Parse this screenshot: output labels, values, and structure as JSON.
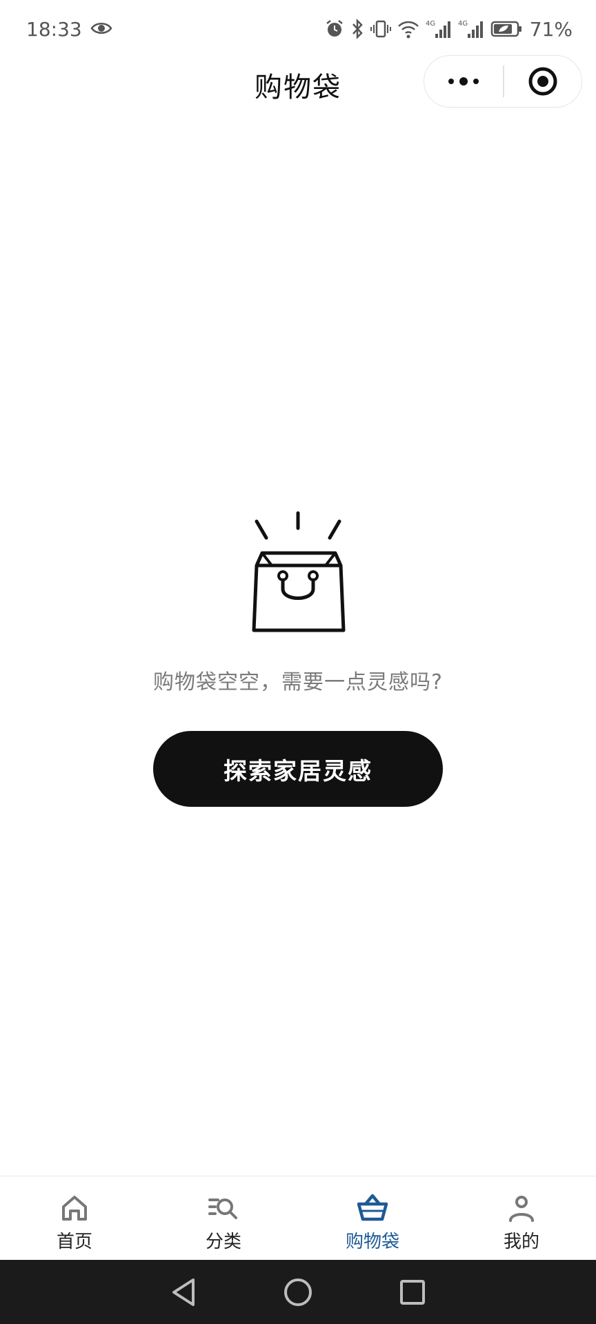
{
  "status_bar": {
    "time": "18:33",
    "battery_percent": "71%",
    "network_1": "4G",
    "network_2": "4G"
  },
  "nav": {
    "title": "购物袋"
  },
  "empty_state": {
    "illustration": "shopping-bag-icon",
    "message": "购物袋空空，需要一点灵感吗?",
    "button_label": "探索家居灵感"
  },
  "tabs": [
    {
      "label": "首页",
      "icon": "home-icon",
      "active": false
    },
    {
      "label": "分类",
      "icon": "category-search-icon",
      "active": false
    },
    {
      "label": "购物袋",
      "icon": "basket-icon",
      "active": true
    },
    {
      "label": "我的",
      "icon": "user-icon",
      "active": false
    }
  ],
  "colors": {
    "accent": "#1d5a96",
    "button_bg": "#111111",
    "nav_bg": "#1b1b1b"
  }
}
